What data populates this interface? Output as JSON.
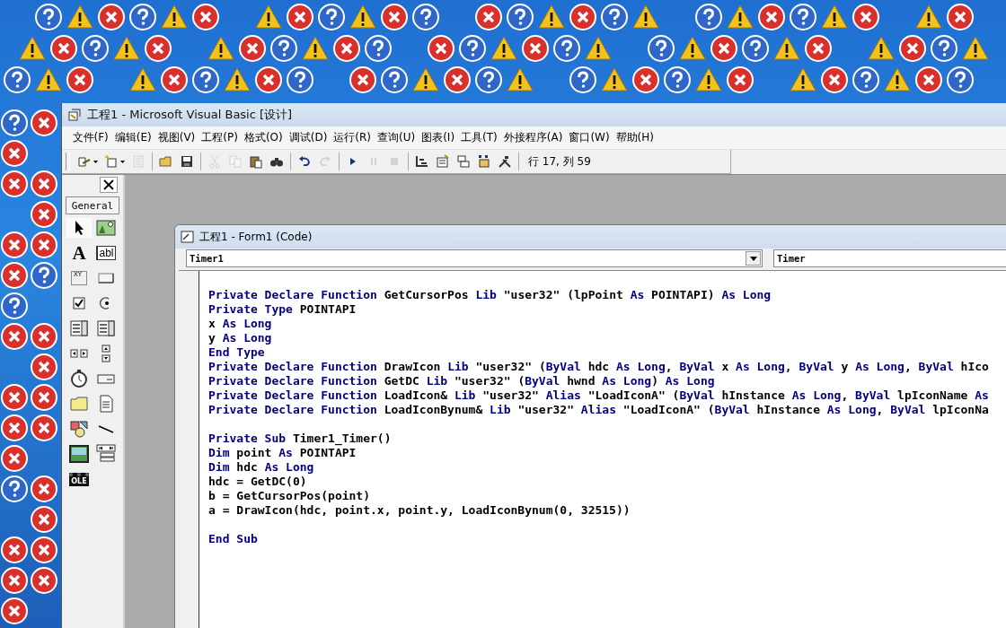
{
  "window": {
    "title": "工程1 - Microsoft Visual Basic [设计]"
  },
  "menu": [
    "文件(F)",
    "编辑(E)",
    "视图(V)",
    "工程(P)",
    "格式(O)",
    "调试(D)",
    "运行(R)",
    "查询(U)",
    "图表(I)",
    "工具(T)",
    "外接程序(A)",
    "窗口(W)",
    "帮助(H)"
  ],
  "toolbar": {
    "buttons": [
      {
        "kind": "add-project",
        "disabled": false,
        "dropdown": true
      },
      {
        "kind": "add-form",
        "disabled": false,
        "dropdown": true
      },
      {
        "kind": "menu-editor",
        "disabled": true,
        "dropdown": false
      },
      {
        "kind": "separator"
      },
      {
        "kind": "open",
        "disabled": false,
        "dropdown": false
      },
      {
        "kind": "save",
        "disabled": false,
        "dropdown": false
      },
      {
        "kind": "separator"
      },
      {
        "kind": "cut",
        "disabled": true,
        "dropdown": false
      },
      {
        "kind": "copy",
        "disabled": true,
        "dropdown": false
      },
      {
        "kind": "paste",
        "disabled": false,
        "dropdown": false
      },
      {
        "kind": "find",
        "disabled": false,
        "dropdown": false
      },
      {
        "kind": "separator"
      },
      {
        "kind": "undo",
        "disabled": false,
        "dropdown": false
      },
      {
        "kind": "redo",
        "disabled": true,
        "dropdown": false
      },
      {
        "kind": "separator"
      },
      {
        "kind": "start",
        "disabled": false,
        "dropdown": false
      },
      {
        "kind": "pause",
        "disabled": true,
        "dropdown": false
      },
      {
        "kind": "stop",
        "disabled": true,
        "dropdown": false
      },
      {
        "kind": "separator"
      },
      {
        "kind": "project-explorer",
        "disabled": false,
        "dropdown": false
      },
      {
        "kind": "properties",
        "disabled": false,
        "dropdown": false
      },
      {
        "kind": "form-layout",
        "disabled": false,
        "dropdown": false
      },
      {
        "kind": "object-browser",
        "disabled": false,
        "dropdown": false
      },
      {
        "kind": "toolbox",
        "disabled": false,
        "dropdown": false
      },
      {
        "kind": "separator"
      }
    ],
    "position": "行 17, 列 59"
  },
  "toolbox": {
    "tab": "General",
    "tools": [
      {
        "kind": "pointer"
      },
      {
        "kind": "picture"
      },
      {
        "kind": "label",
        "label": "A"
      },
      {
        "kind": "textbox",
        "label": "abl"
      },
      {
        "kind": "frame",
        "label": "XY"
      },
      {
        "kind": "command"
      },
      {
        "kind": "checkbox"
      },
      {
        "kind": "option"
      },
      {
        "kind": "combo"
      },
      {
        "kind": "list"
      },
      {
        "kind": "hscroll"
      },
      {
        "kind": "vscroll"
      },
      {
        "kind": "timer"
      },
      {
        "kind": "drive"
      },
      {
        "kind": "dir"
      },
      {
        "kind": "file"
      },
      {
        "kind": "shape"
      },
      {
        "kind": "line"
      },
      {
        "kind": "image"
      },
      {
        "kind": "data"
      },
      {
        "kind": "ole",
        "label": "OLE"
      }
    ]
  },
  "code_window": {
    "title": "工程1 - Form1 (Code)",
    "object": "Timer1",
    "procedure": "Timer",
    "lines": [
      {
        "kind": "blank"
      },
      {
        "kind": "code",
        "segments": [
          {
            "kind": "keyword",
            "text": "Private Declare Function"
          },
          {
            "kind": "plain",
            "text": " GetCursorPos "
          },
          {
            "kind": "keyword",
            "text": "Lib"
          },
          {
            "kind": "plain",
            "text": " \"user32\" (lpPoint "
          },
          {
            "kind": "keyword",
            "text": "As"
          },
          {
            "kind": "plain",
            "text": " POINTAPI) "
          },
          {
            "kind": "keyword",
            "text": "As Long"
          }
        ]
      },
      {
        "kind": "code",
        "segments": [
          {
            "kind": "keyword",
            "text": "Private Type"
          },
          {
            "kind": "plain",
            "text": " POINTAPI"
          }
        ]
      },
      {
        "kind": "code",
        "segments": [
          {
            "kind": "plain",
            "text": "x "
          },
          {
            "kind": "keyword",
            "text": "As Long"
          }
        ]
      },
      {
        "kind": "code",
        "segments": [
          {
            "kind": "plain",
            "text": "y "
          },
          {
            "kind": "keyword",
            "text": "As Long"
          }
        ]
      },
      {
        "kind": "code",
        "segments": [
          {
            "kind": "keyword",
            "text": "End Type"
          }
        ]
      },
      {
        "kind": "code",
        "segments": [
          {
            "kind": "keyword",
            "text": "Private Declare Function"
          },
          {
            "kind": "plain",
            "text": " DrawIcon "
          },
          {
            "kind": "keyword",
            "text": "Lib"
          },
          {
            "kind": "plain",
            "text": " \"user32\" ("
          },
          {
            "kind": "keyword",
            "text": "ByVal"
          },
          {
            "kind": "plain",
            "text": " hdc "
          },
          {
            "kind": "keyword",
            "text": "As Long"
          },
          {
            "kind": "plain",
            "text": ", "
          },
          {
            "kind": "keyword",
            "text": "ByVal"
          },
          {
            "kind": "plain",
            "text": " x "
          },
          {
            "kind": "keyword",
            "text": "As Long"
          },
          {
            "kind": "plain",
            "text": ", "
          },
          {
            "kind": "keyword",
            "text": "ByVal"
          },
          {
            "kind": "plain",
            "text": " y "
          },
          {
            "kind": "keyword",
            "text": "As Long"
          },
          {
            "kind": "plain",
            "text": ", "
          },
          {
            "kind": "keyword",
            "text": "ByVal"
          },
          {
            "kind": "plain",
            "text": " hIco"
          }
        ]
      },
      {
        "kind": "code",
        "segments": [
          {
            "kind": "keyword",
            "text": "Private Declare Function"
          },
          {
            "kind": "plain",
            "text": " GetDC "
          },
          {
            "kind": "keyword",
            "text": "Lib"
          },
          {
            "kind": "plain",
            "text": " \"user32\" ("
          },
          {
            "kind": "keyword",
            "text": "ByVal"
          },
          {
            "kind": "plain",
            "text": " hwnd "
          },
          {
            "kind": "keyword",
            "text": "As Long"
          },
          {
            "kind": "plain",
            "text": ") "
          },
          {
            "kind": "keyword",
            "text": "As Long"
          }
        ]
      },
      {
        "kind": "code",
        "segments": [
          {
            "kind": "keyword",
            "text": "Private Declare Function"
          },
          {
            "kind": "plain",
            "text": " LoadIcon& "
          },
          {
            "kind": "keyword",
            "text": "Lib"
          },
          {
            "kind": "plain",
            "text": " \"user32\" "
          },
          {
            "kind": "keyword",
            "text": "Alias"
          },
          {
            "kind": "plain",
            "text": " \"LoadIconA\" ("
          },
          {
            "kind": "keyword",
            "text": "ByVal"
          },
          {
            "kind": "plain",
            "text": " hInstance "
          },
          {
            "kind": "keyword",
            "text": "As Long"
          },
          {
            "kind": "plain",
            "text": ", "
          },
          {
            "kind": "keyword",
            "text": "ByVal"
          },
          {
            "kind": "plain",
            "text": " lpIconName "
          },
          {
            "kind": "keyword",
            "text": "As"
          }
        ]
      },
      {
        "kind": "code",
        "segments": [
          {
            "kind": "keyword",
            "text": "Private Declare Function"
          },
          {
            "kind": "plain",
            "text": " LoadIconBynum& "
          },
          {
            "kind": "keyword",
            "text": "Lib"
          },
          {
            "kind": "plain",
            "text": " \"user32\" "
          },
          {
            "kind": "keyword",
            "text": "Alias"
          },
          {
            "kind": "plain",
            "text": " \"LoadIconA\" ("
          },
          {
            "kind": "keyword",
            "text": "ByVal"
          },
          {
            "kind": "plain",
            "text": " hInstance "
          },
          {
            "kind": "keyword",
            "text": "As Long"
          },
          {
            "kind": "plain",
            "text": ", "
          },
          {
            "kind": "keyword",
            "text": "ByVal"
          },
          {
            "kind": "plain",
            "text": " lpIconNa"
          }
        ]
      },
      {
        "kind": "blank"
      },
      {
        "kind": "code",
        "segments": [
          {
            "kind": "keyword",
            "text": "Private Sub"
          },
          {
            "kind": "plain",
            "text": " Timer1_Timer()"
          }
        ]
      },
      {
        "kind": "code",
        "segments": [
          {
            "kind": "keyword",
            "text": "Dim"
          },
          {
            "kind": "plain",
            "text": " point "
          },
          {
            "kind": "keyword",
            "text": "As"
          },
          {
            "kind": "plain",
            "text": " POINTAPI"
          }
        ]
      },
      {
        "kind": "code",
        "segments": [
          {
            "kind": "keyword",
            "text": "Dim"
          },
          {
            "kind": "plain",
            "text": " hdc "
          },
          {
            "kind": "keyword",
            "text": "As Long"
          }
        ]
      },
      {
        "kind": "code",
        "segments": [
          {
            "kind": "plain",
            "text": "hdc = GetDC(0)"
          }
        ]
      },
      {
        "kind": "code",
        "segments": [
          {
            "kind": "plain",
            "text": "b = GetCursorPos(point)"
          }
        ]
      },
      {
        "kind": "code",
        "segments": [
          {
            "kind": "plain",
            "text": "a = DrawIcon(hdc, point.x, point.y, LoadIconBynum(0, 32515))"
          }
        ]
      },
      {
        "kind": "blank"
      },
      {
        "kind": "code",
        "segments": [
          {
            "kind": "keyword",
            "text": "End Sub"
          }
        ]
      }
    ]
  }
}
